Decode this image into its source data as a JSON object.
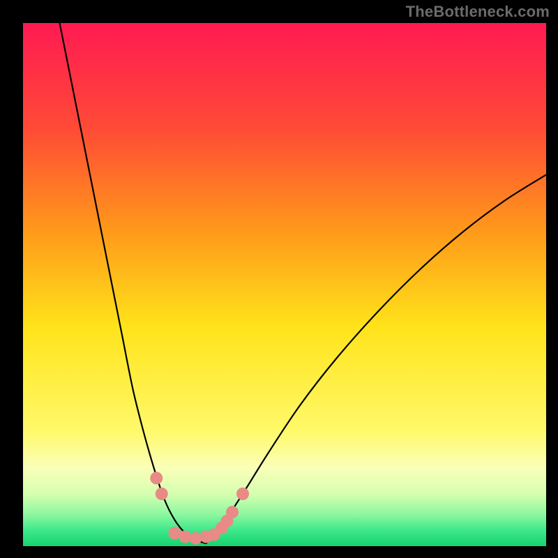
{
  "watermark": "TheBottleneck.com",
  "chart_data": {
    "type": "line",
    "title": "",
    "xlabel": "",
    "ylabel": "",
    "xlim": [
      0,
      100
    ],
    "ylim": [
      0,
      100
    ],
    "background_gradient": {
      "type": "vertical",
      "stops": [
        {
          "offset": 0.0,
          "color": "#ff1a52"
        },
        {
          "offset": 0.2,
          "color": "#ff4a36"
        },
        {
          "offset": 0.4,
          "color": "#ff9a1a"
        },
        {
          "offset": 0.58,
          "color": "#ffe31a"
        },
        {
          "offset": 0.78,
          "color": "#fff96a"
        },
        {
          "offset": 0.85,
          "color": "#faffb8"
        },
        {
          "offset": 0.9,
          "color": "#d6ffb0"
        },
        {
          "offset": 0.94,
          "color": "#8cf7a0"
        },
        {
          "offset": 0.97,
          "color": "#3de88a"
        },
        {
          "offset": 1.0,
          "color": "#17d36e"
        }
      ]
    },
    "series": [
      {
        "name": "curve-left",
        "color": "#000000",
        "points": [
          {
            "x": 7.0,
            "y": 100.0
          },
          {
            "x": 9.0,
            "y": 90.0
          },
          {
            "x": 11.0,
            "y": 80.0
          },
          {
            "x": 13.0,
            "y": 70.0
          },
          {
            "x": 15.0,
            "y": 60.0
          },
          {
            "x": 17.0,
            "y": 50.0
          },
          {
            "x": 19.0,
            "y": 40.0
          },
          {
            "x": 21.0,
            "y": 30.0
          },
          {
            "x": 23.0,
            "y": 22.0
          },
          {
            "x": 25.0,
            "y": 15.0
          },
          {
            "x": 27.0,
            "y": 9.0
          },
          {
            "x": 29.0,
            "y": 5.0
          },
          {
            "x": 31.0,
            "y": 2.5
          },
          {
            "x": 33.0,
            "y": 1.2
          },
          {
            "x": 35.0,
            "y": 0.5
          }
        ]
      },
      {
        "name": "curve-right",
        "color": "#000000",
        "points": [
          {
            "x": 35.0,
            "y": 0.5
          },
          {
            "x": 38.0,
            "y": 4.0
          },
          {
            "x": 42.0,
            "y": 10.0
          },
          {
            "x": 47.0,
            "y": 18.0
          },
          {
            "x": 53.0,
            "y": 27.0
          },
          {
            "x": 60.0,
            "y": 36.0
          },
          {
            "x": 68.0,
            "y": 45.0
          },
          {
            "x": 76.0,
            "y": 53.0
          },
          {
            "x": 84.0,
            "y": 60.0
          },
          {
            "x": 92.0,
            "y": 66.0
          },
          {
            "x": 100.0,
            "y": 71.0
          }
        ]
      }
    ],
    "markers": {
      "name": "highlight-dots",
      "color": "#e88a85",
      "radius_px": 9,
      "points": [
        {
          "x": 25.5,
          "y": 13.0
        },
        {
          "x": 26.5,
          "y": 10.0
        },
        {
          "x": 29.0,
          "y": 2.5
        },
        {
          "x": 31.0,
          "y": 1.8
        },
        {
          "x": 33.0,
          "y": 1.5
        },
        {
          "x": 35.0,
          "y": 1.8
        },
        {
          "x": 36.5,
          "y": 2.2
        },
        {
          "x": 38.0,
          "y": 3.5
        },
        {
          "x": 39.0,
          "y": 4.8
        },
        {
          "x": 40.0,
          "y": 6.5
        },
        {
          "x": 42.0,
          "y": 10.0
        }
      ]
    }
  }
}
